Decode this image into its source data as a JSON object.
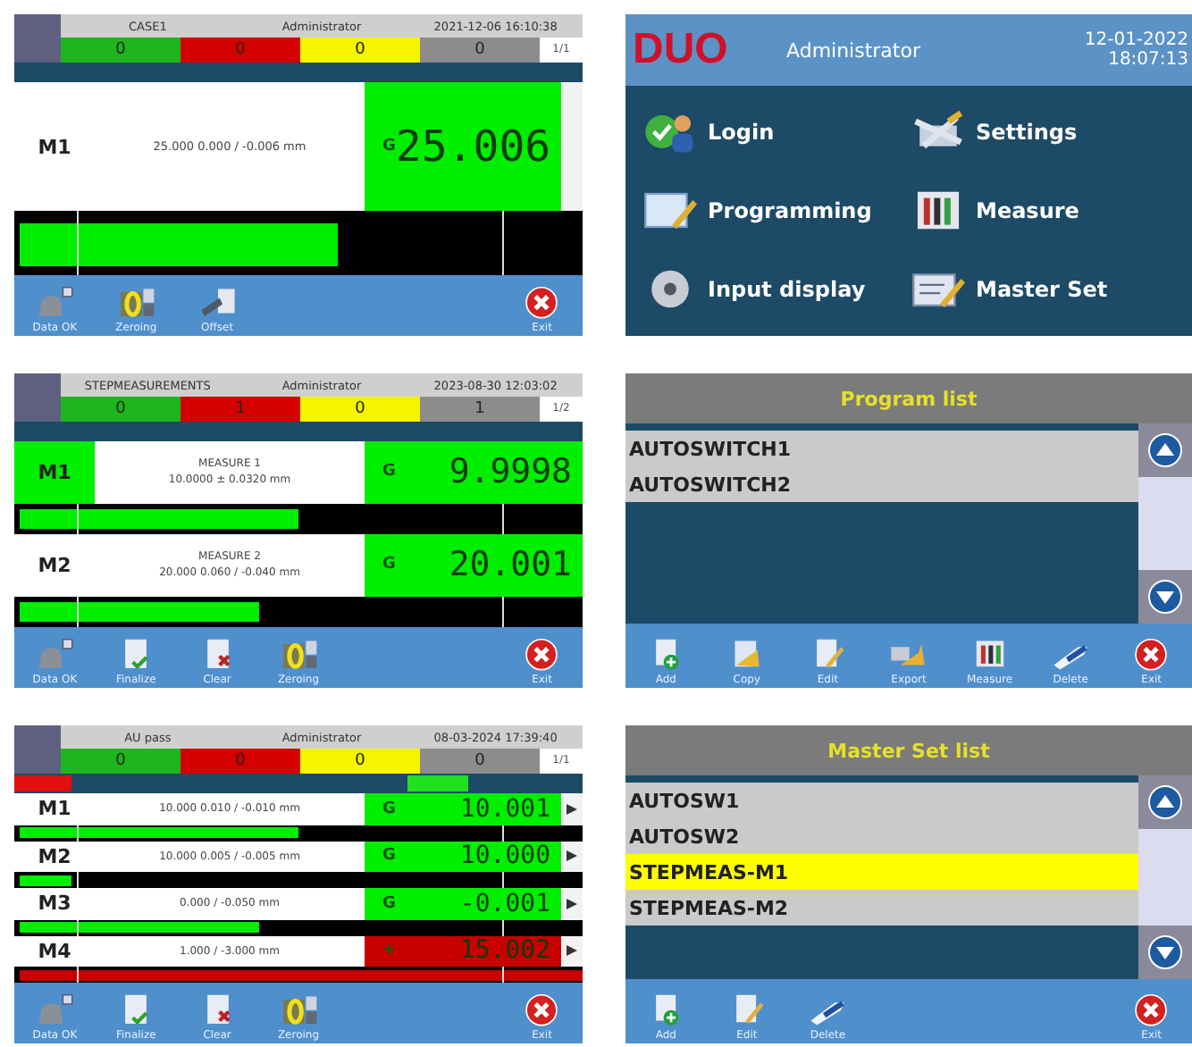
{
  "screens": [
    {
      "kind": "measure",
      "program": "CASE1",
      "user": "Administrator",
      "datetime": "2021-12-06 16:10:38",
      "counters": [
        {
          "value": "0",
          "color": "#1fb51f"
        },
        {
          "value": "0",
          "color": "#d40000"
        },
        {
          "value": "0",
          "color": "#f5f500"
        },
        {
          "value": "0",
          "color": "#8c8c8c"
        }
      ],
      "page": "1/1",
      "rows": [
        {
          "label": "M1",
          "highlighted": false,
          "tolerance": "25.000 0.000 / -0.006 mm",
          "status": "G",
          "value": "25.006",
          "ok": true,
          "level": 0.57,
          "side_tab": true
        }
      ],
      "tools": [
        {
          "kind": "dataok",
          "label": "Data OK"
        },
        {
          "kind": "zeroing",
          "label": "Zeroing"
        },
        {
          "kind": "offset",
          "label": "Offset"
        },
        {
          "kind": "exit",
          "label": "Exit"
        }
      ]
    },
    {
      "kind": "menu",
      "logo": "DUO",
      "user": "Administrator",
      "date": "12-01-2022",
      "time": "18:07:13",
      "items": [
        {
          "kind": "login",
          "label": "Login"
        },
        {
          "kind": "settings",
          "label": "Settings"
        },
        {
          "kind": "programming",
          "label": "Programming"
        },
        {
          "kind": "measure",
          "label": "Measure"
        },
        {
          "kind": "input",
          "label": "Input display"
        },
        {
          "kind": "master",
          "label": "Master Set"
        }
      ]
    },
    {
      "kind": "measure",
      "program": "STEPMEASUREMENTS",
      "user": "Administrator",
      "datetime": "2023-08-30 12:03:02",
      "counters": [
        {
          "value": "0",
          "color": "#1fb51f"
        },
        {
          "value": "1",
          "color": "#d40000"
        },
        {
          "value": "0",
          "color": "#f5f500"
        },
        {
          "value": "1",
          "color": "#8c8c8c"
        }
      ],
      "page": "1/2",
      "rows": [
        {
          "label": "M1",
          "highlighted": true,
          "description": "MEASURE 1",
          "tolerance": "10.0000 ± 0.0320 mm",
          "status": "G",
          "value": "9.9998",
          "ok": true,
          "level": 0.5
        },
        {
          "label": "M2",
          "highlighted": false,
          "description": "MEASURE 2",
          "tolerance": "20.000 0.060 / -0.040 mm",
          "status": "G",
          "value": "20.001",
          "ok": true,
          "level": 0.43
        }
      ],
      "tools": [
        {
          "kind": "dataok",
          "label": "Data OK"
        },
        {
          "kind": "finalize",
          "label": "Finalize"
        },
        {
          "kind": "clear",
          "label": "Clear"
        },
        {
          "kind": "zeroing",
          "label": "Zeroing"
        },
        {
          "kind": "exit",
          "label": "Exit"
        }
      ]
    },
    {
      "kind": "list",
      "title": "Program list",
      "items": [
        {
          "label": "AUTOSWITCH1",
          "selected": false
        },
        {
          "label": "AUTOSWITCH2",
          "selected": false
        }
      ],
      "tools": [
        {
          "kind": "add",
          "label": "Add"
        },
        {
          "kind": "copy",
          "label": "Copy"
        },
        {
          "kind": "edit",
          "label": "Edit"
        },
        {
          "kind": "export",
          "label": "Export"
        },
        {
          "kind": "measure",
          "label": "Measure"
        },
        {
          "kind": "delete",
          "label": "Delete"
        },
        {
          "kind": "exit",
          "label": "Exit"
        }
      ]
    },
    {
      "kind": "measure",
      "program": "AU pass",
      "user": "Administrator",
      "datetime": "08-03-2024 17:39:40",
      "counters": [
        {
          "value": "0",
          "color": "#1fb51f"
        },
        {
          "value": "0",
          "color": "#d40000"
        },
        {
          "value": "0",
          "color": "#f5f500"
        },
        {
          "value": "0",
          "color": "#8c8c8c"
        }
      ],
      "page": "1/1",
      "indicators": [
        {
          "color": "#e01010"
        },
        {
          "color": "#20e020"
        }
      ],
      "rows": [
        {
          "label": "M1",
          "highlighted": false,
          "tolerance": "10.000 0.010 / -0.010 mm",
          "status": "G",
          "value": "10.001",
          "ok": true,
          "level": 0.5,
          "side_arrow": true
        },
        {
          "label": "M2",
          "highlighted": false,
          "tolerance": "10.000 0.005 / -0.005 mm",
          "status": "G",
          "value": "10.000",
          "ok": true,
          "level": 0.1,
          "side_arrow": true
        },
        {
          "label": "M3",
          "highlighted": false,
          "tolerance": "0.000 / -0.050 mm",
          "status": "G",
          "value": "-0.001",
          "ok": true,
          "level": 0.43,
          "side_arrow": true
        },
        {
          "label": "M4",
          "highlighted": false,
          "tolerance": "1.000 / -3.000 mm",
          "status": "+",
          "value": "15.002",
          "ok": false,
          "level": 1,
          "side_arrow": true
        }
      ],
      "tools": [
        {
          "kind": "dataok",
          "label": "Data OK"
        },
        {
          "kind": "finalize",
          "label": "Finalize"
        },
        {
          "kind": "clear",
          "label": "Clear"
        },
        {
          "kind": "zeroing",
          "label": "Zeroing"
        },
        {
          "kind": "exit",
          "label": "Exit"
        }
      ]
    },
    {
      "kind": "list",
      "title": "Master Set list",
      "items": [
        {
          "label": "AUTOSW1",
          "selected": false
        },
        {
          "label": "AUTOSW2",
          "selected": false
        },
        {
          "label": "STEPMEAS-M1",
          "selected": true
        },
        {
          "label": "STEPMEAS-M2",
          "selected": false
        }
      ],
      "tools": [
        {
          "kind": "add",
          "label": "Add"
        },
        {
          "kind": "edit",
          "label": "Edit"
        },
        {
          "kind": "delete",
          "label": "Delete"
        },
        {
          "kind": "exit",
          "label": "Exit"
        }
      ]
    }
  ]
}
